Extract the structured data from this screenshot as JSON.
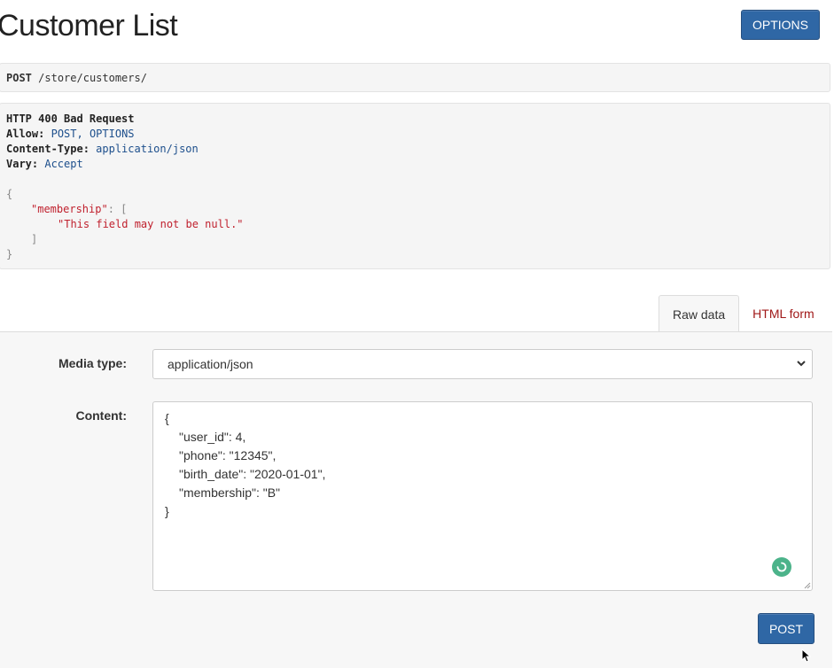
{
  "page": {
    "title": "Customer List",
    "options_label": "OPTIONS"
  },
  "request": {
    "method": "POST",
    "path": "/store/customers/"
  },
  "response": {
    "status_line": "HTTP 400 Bad Request",
    "headers": [
      {
        "key": "Allow:",
        "value": "POST, OPTIONS"
      },
      {
        "key": "Content-Type:",
        "value": "application/json"
      },
      {
        "key": "Vary:",
        "value": "Accept"
      }
    ],
    "body": {
      "open_brace": "{",
      "field_key": "\"membership\"",
      "colon_bracket": ": [",
      "error_message": "\"This field may not be null.\"",
      "close_bracket": "]",
      "close_brace": "}"
    }
  },
  "tabs": {
    "raw": "Raw data",
    "html": "HTML form"
  },
  "form": {
    "media_label": "Media type:",
    "media_value": "application/json",
    "content_label": "Content:",
    "content_lines": [
      "{",
      "\"user_id\": 4,",
      "\"phone\": \"12345\",",
      "\"birth_date\": \"2020-01-01\",",
      "\"membership\": \"B\"",
      "}"
    ],
    "post_label": "POST"
  },
  "colors": {
    "primary": "#2f67a5",
    "error_string": "#c0212e",
    "link_tab": "#a01818",
    "spinner": "#4cb38a"
  }
}
